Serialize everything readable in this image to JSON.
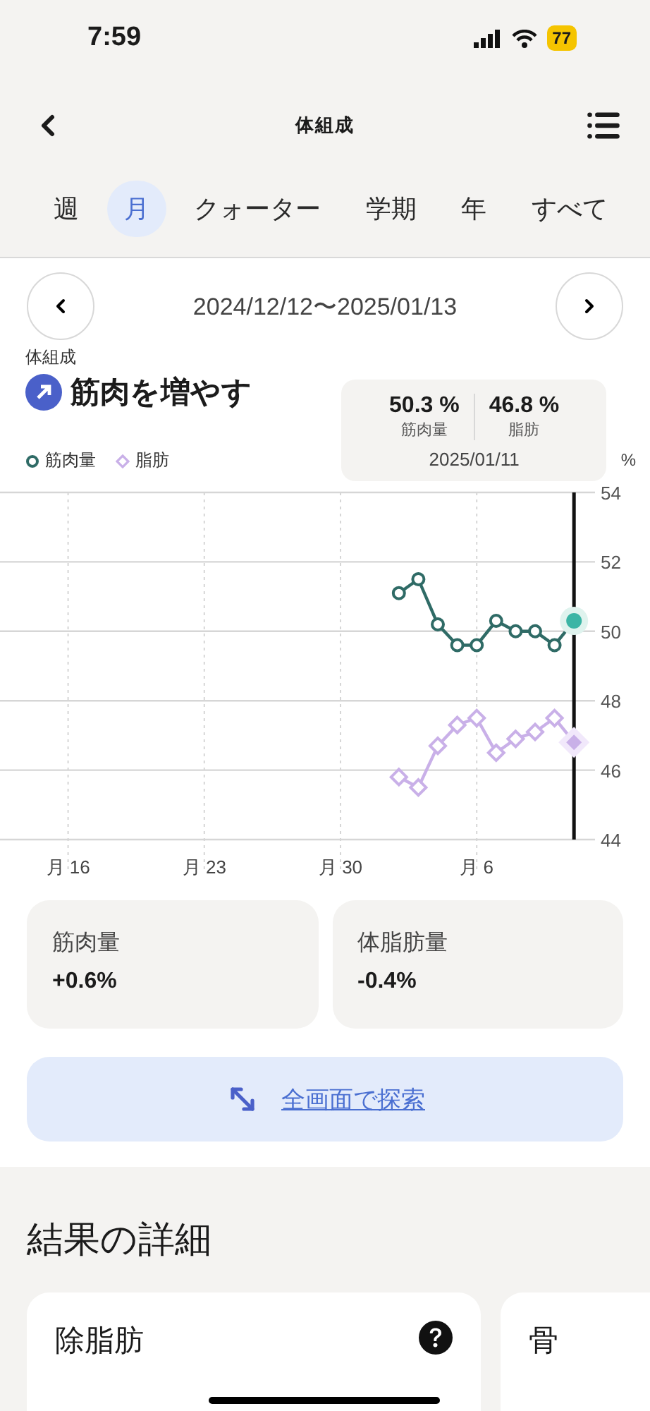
{
  "status_bar": {
    "time": "7:59",
    "battery": "77"
  },
  "header": {
    "title": "体組成"
  },
  "tabs": [
    {
      "label": "週",
      "selected": false
    },
    {
      "label": "月",
      "selected": true
    },
    {
      "label": "クォーター",
      "selected": false
    },
    {
      "label": "学期",
      "selected": false
    },
    {
      "label": "年",
      "selected": false
    },
    {
      "label": "すべて",
      "selected": false
    }
  ],
  "date_range": "2024/12/12〜2025/01/13",
  "section_label": "体組成",
  "goal": "筋肉を増やす",
  "tooltip": {
    "readings": [
      {
        "value": "50.3 %",
        "label": "筋肉量"
      },
      {
        "value": "46.8 %",
        "label": "脂肪"
      }
    ],
    "date": "2025/01/11"
  },
  "chart_data": {
    "type": "line",
    "ylabel": "%",
    "categories": [
      null,
      null,
      null,
      "月 16",
      null,
      null,
      null,
      null,
      null,
      null,
      "月 23",
      null,
      null,
      null,
      null,
      null,
      null,
      "月 30",
      null,
      null,
      null,
      null,
      null,
      null,
      "月 6",
      null,
      null,
      null,
      null,
      null
    ],
    "series": [
      {
        "name": "筋肉量",
        "color": "#2f6b66",
        "marker": "circle",
        "values": [
          null,
          null,
          null,
          null,
          null,
          null,
          null,
          null,
          null,
          null,
          null,
          null,
          null,
          null,
          null,
          null,
          null,
          null,
          null,
          null,
          51.1,
          51.5,
          50.2,
          49.6,
          49.6,
          50.3,
          50.0,
          50.0,
          49.6,
          50.3
        ]
      },
      {
        "name": "脂肪",
        "color": "#c9b0e8",
        "marker": "diamond",
        "values": [
          null,
          null,
          null,
          null,
          null,
          null,
          null,
          null,
          null,
          null,
          null,
          null,
          null,
          null,
          null,
          null,
          null,
          null,
          null,
          null,
          45.8,
          45.5,
          46.7,
          47.3,
          47.5,
          46.5,
          46.9,
          47.1,
          47.5,
          46.8
        ]
      }
    ],
    "ylim": [
      44,
      54
    ],
    "yticks": [
      44,
      46,
      48,
      50,
      52,
      54
    ],
    "grid": true
  },
  "summary": [
    {
      "label": "筋肉量",
      "value": "+0.6%"
    },
    {
      "label": "体脂肪量",
      "value": "-0.4%"
    }
  ],
  "explore_button": "全画面で探索",
  "details": {
    "title": "結果の詳細",
    "cards": [
      {
        "title": "除脂肪",
        "help": true
      },
      {
        "title": "骨"
      }
    ]
  }
}
